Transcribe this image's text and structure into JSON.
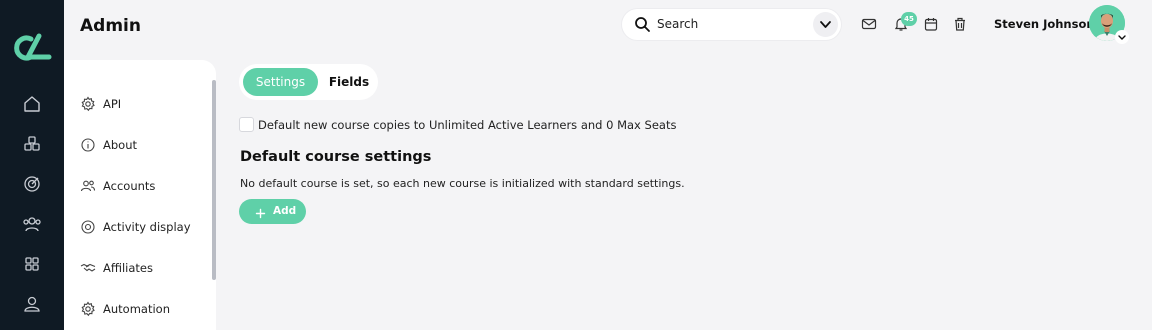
{
  "app": {
    "title": "Admin"
  },
  "rail": {
    "items": [
      {
        "icon": "home-icon"
      },
      {
        "icon": "cubes-icon"
      },
      {
        "icon": "target-icon"
      },
      {
        "icon": "users-icon"
      },
      {
        "icon": "apps-grid-icon"
      },
      {
        "icon": "user-icon"
      }
    ]
  },
  "header": {
    "search": {
      "placeholder": "Search"
    },
    "notifications_count": "45",
    "user": {
      "name": "Steven Johnson"
    }
  },
  "settings_nav": {
    "items": [
      {
        "label": "API",
        "icon": "gear-icon"
      },
      {
        "label": "About",
        "icon": "info-icon"
      },
      {
        "label": "Accounts",
        "icon": "accounts-icon"
      },
      {
        "label": "Activity display",
        "icon": "target-icon"
      },
      {
        "label": "Affiliates",
        "icon": "handshake-icon"
      },
      {
        "label": "Automation",
        "icon": "gear-icon"
      }
    ]
  },
  "tabs": [
    {
      "label": "Settings",
      "active": true
    },
    {
      "label": "Fields",
      "active": false
    }
  ],
  "content": {
    "checkbox": {
      "label": "Default new course copies to Unlimited Active Learners and 0 Max Seats",
      "checked": false
    },
    "section_title": "Default course settings",
    "section_desc": "No default course is set, so each new course is initialized with standard settings.",
    "add_button": "Add"
  },
  "colors": {
    "accent": "#5fd0a8",
    "rail": "#0f1a24",
    "background": "#f4f4f6"
  }
}
